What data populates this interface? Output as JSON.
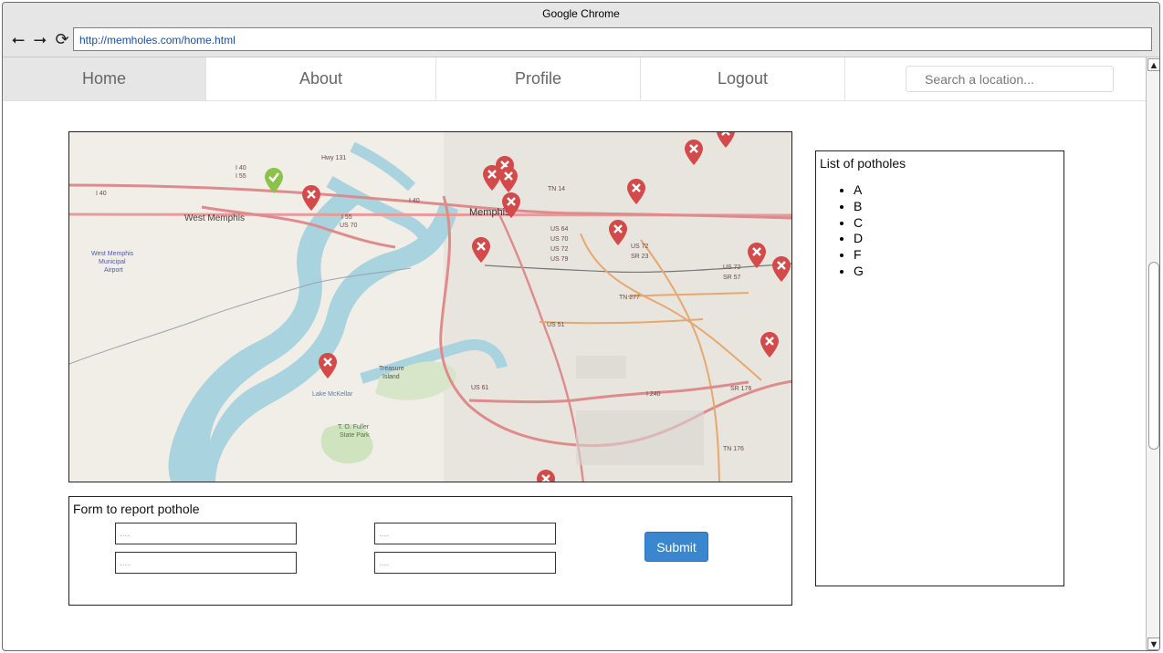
{
  "window": {
    "title": "Google Chrome"
  },
  "browser": {
    "url": "http://memholes.com/home.html",
    "back_icon": "arrow-left-icon",
    "forward_icon": "arrow-right-icon",
    "reload_icon": "reload-icon"
  },
  "nav": {
    "items": [
      {
        "label": "Home",
        "active": true
      },
      {
        "label": "About"
      },
      {
        "label": "Profile"
      },
      {
        "label": "Logout"
      }
    ],
    "search_placeholder": "Search a location..."
  },
  "map": {
    "labels": [
      "West Memphis",
      "Memphis",
      "West Memphis Municipal Airport",
      "Treasure Island",
      "Lake McKellar",
      "T. O. Fuller State Park",
      "I 40",
      "I 55",
      "Hwy 131",
      "US 70",
      "TN 14",
      "US 64",
      "US 72",
      "US 79",
      "SR 23",
      "TN 277",
      "US 51",
      "US 61",
      "I 240",
      "SR 176",
      "TN 176",
      "SR 57"
    ]
  },
  "potholes": {
    "title": "List of potholes",
    "items": [
      "A",
      "B",
      "C",
      "D",
      "F",
      "G"
    ]
  },
  "form": {
    "title": "Form to report pothole",
    "field_placeholder": "....",
    "submit_label": "Submit"
  },
  "colors": {
    "accent": "#3a87cf",
    "marker_red": "#d24a4a",
    "marker_green": "#8bc34a"
  }
}
